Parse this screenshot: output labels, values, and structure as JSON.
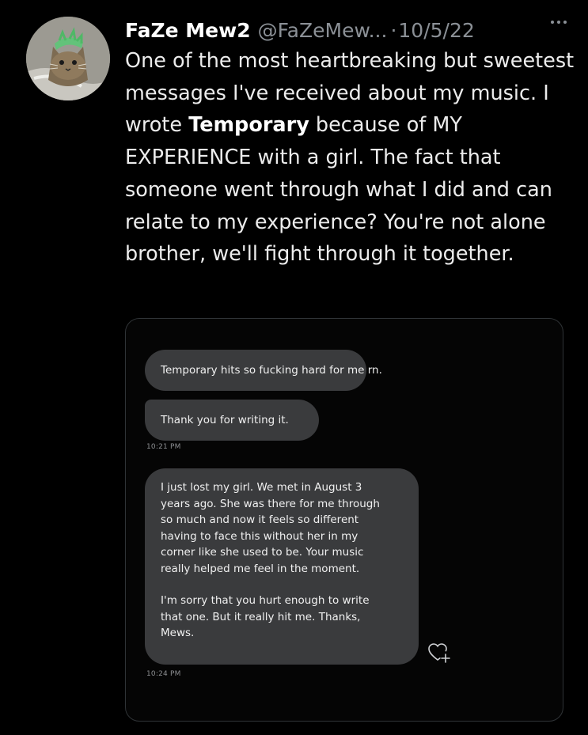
{
  "tweet": {
    "author_name": "FaZe Mew2",
    "handle": "@FaZeMew...",
    "separator": "·",
    "date": "10/5/22",
    "text_before_bold": "One of the most heartbreaking but sweetest messages I've received about my music. I wrote ",
    "text_bold": "Temporary",
    "text_after_bold": " because of MY EXPERIENCE with a girl. The fact that someone went through what I did and can relate to my experience? You're not alone brother, we'll fight through it together."
  },
  "dm": {
    "messages": [
      {
        "text": "Temporary hits so fucking hard for me rn."
      },
      {
        "text": "Thank you for writing it."
      },
      {
        "paragraph1": [
          "I just lost my girl. We met in August 3",
          "years ago. She was there for me through",
          "so much and now it feels so different",
          "having to face this without her in my",
          "corner like she used to be. Your music",
          "really helped me feel in the moment."
        ],
        "paragraph2": [
          "I'm sorry that you hurt enough to write",
          "that one. But it really hit me. Thanks,",
          "Mews."
        ]
      }
    ],
    "timestamps": [
      "10:21 PM",
      "10:24 PM"
    ]
  },
  "icons": {
    "avatar": "cat-avatar",
    "more": "more-icon",
    "reaction": "heart-plus-icon"
  },
  "colors": {
    "background": "#000000",
    "text": "#e7e9ea",
    "secondary": "#8b9096",
    "bubble": "#3a3b3d"
  }
}
